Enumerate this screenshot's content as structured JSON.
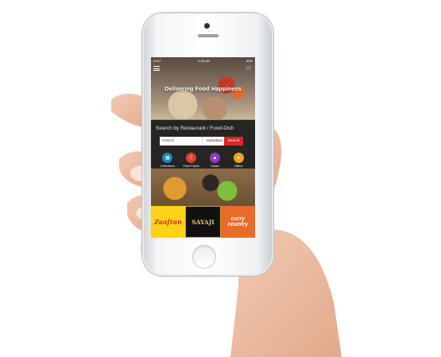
{
  "status_bar": {
    "carrier": "AT&T",
    "time": "9:28 AM",
    "battery": "86%"
  },
  "hero": {
    "title": "Delivering Food Happiness"
  },
  "search": {
    "prompt": "Search by Restaurant / Food-Dish",
    "placeholder": "Search",
    "city": "Vadodara",
    "button_label": "Search"
  },
  "categories": [
    {
      "label": "Collections",
      "icon": "grid-icon",
      "color": "#1f86b8"
    },
    {
      "label": "Food Packs",
      "icon": "fork-knife-icon",
      "color": "#e23b2e"
    },
    {
      "label": "Cakes",
      "icon": "cake-icon",
      "color": "#8a3dbb"
    },
    {
      "label": "Offers",
      "icon": "tag-icon",
      "color": "#f0a11f"
    }
  ],
  "brands": [
    {
      "name": "Zaafran"
    },
    {
      "name": "SAYAJI"
    },
    {
      "name": "curry country"
    }
  ]
}
